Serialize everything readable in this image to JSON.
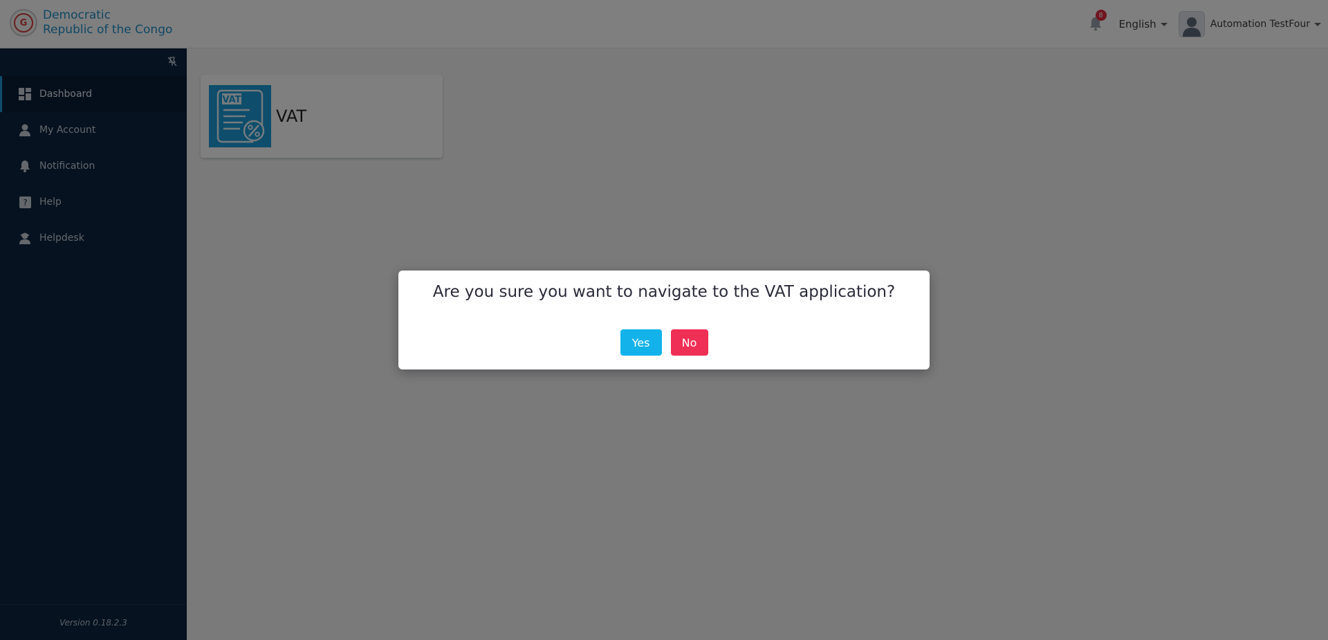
{
  "header": {
    "brand_line1": "Democratic",
    "brand_line2": "Republic of the Congo",
    "notification_count": "8",
    "language": "English",
    "user_name": "Automation TestFour"
  },
  "sidebar": {
    "items": [
      {
        "label": "Dashboard",
        "icon": "dashboard-icon"
      },
      {
        "label": "My Account",
        "icon": "user-icon"
      },
      {
        "label": "Notification",
        "icon": "bell-icon"
      },
      {
        "label": "Help",
        "icon": "help-icon"
      },
      {
        "label": "Helpdesk",
        "icon": "helpdesk-icon"
      }
    ],
    "version": "Version 0.18.2.3"
  },
  "main": {
    "card_title": "VAT",
    "card_icon_text": "VAT"
  },
  "modal": {
    "message": "Are you sure you want to navigate to the VAT application?",
    "yes_label": "Yes",
    "no_label": "No"
  },
  "colors": {
    "brand_blue": "#1f8fc6",
    "sidebar_bg": "#0c2440",
    "yes_button": "#14b2ea",
    "no_button": "#ef2f55",
    "badge_red": "#e0283f"
  }
}
